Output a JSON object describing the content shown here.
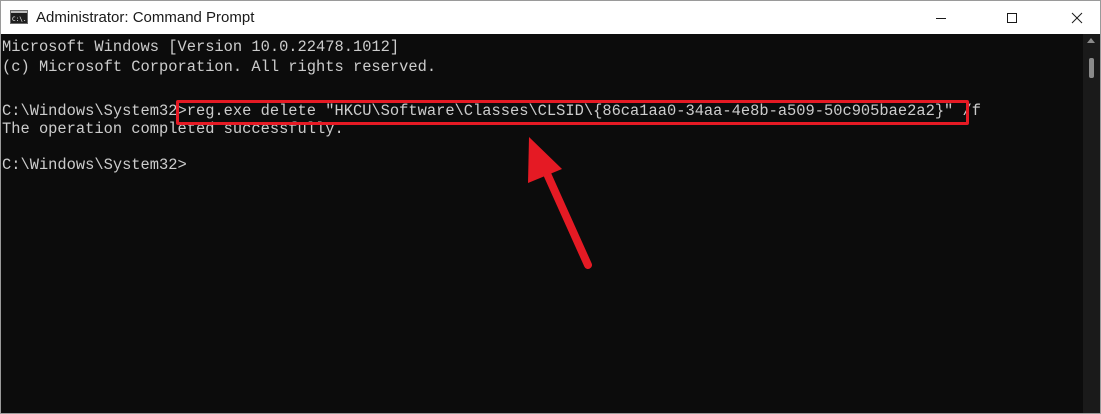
{
  "window": {
    "title": "Administrator: Command Prompt",
    "app_icon_text": "C:\\."
  },
  "console": {
    "lines": [
      "Microsoft Windows [Version 10.0.22478.1012]",
      "(c) Microsoft Corporation. All rights reserved.",
      "",
      "C:\\Windows\\System32>reg.exe delete \"HKCU\\Software\\Classes\\CLSID\\{86ca1aa0-34aa-4e8b-a509-50c905bae2a2}\" /f",
      "The operation completed successfully.",
      "",
      "C:\\Windows\\System32>"
    ]
  },
  "colors": {
    "console_bg": "#0c0c0c",
    "console_text": "#cccccc",
    "annotation": "#e51a24"
  },
  "icons": {
    "minimize": "minimize-icon",
    "maximize": "maximize-icon",
    "close": "close-icon"
  }
}
